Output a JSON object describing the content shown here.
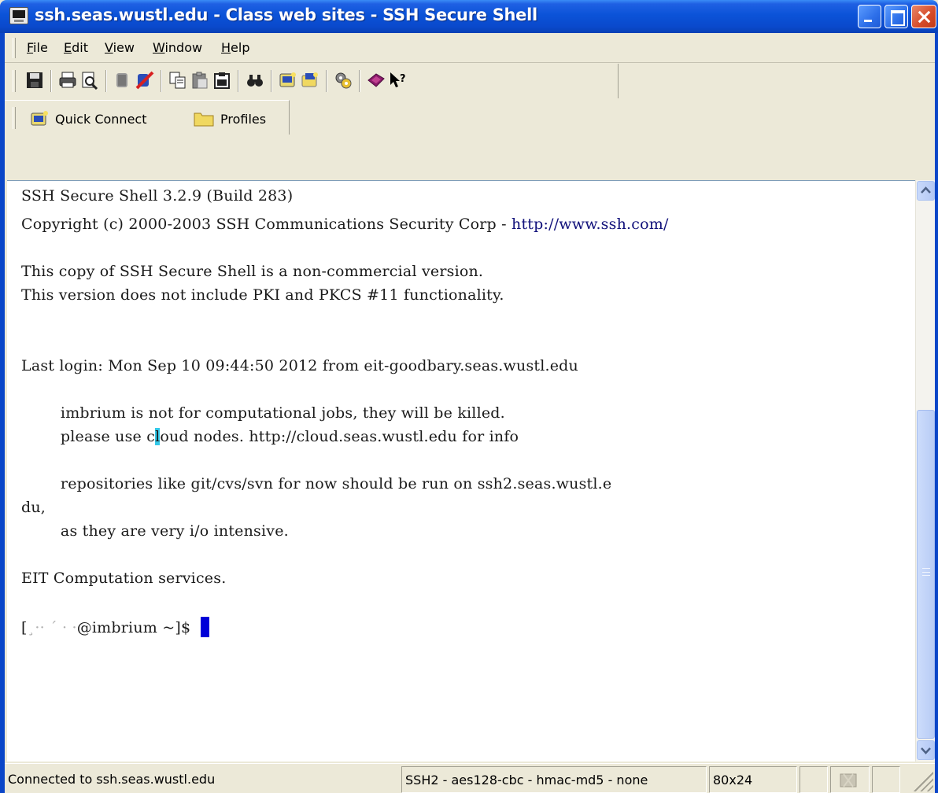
{
  "window": {
    "title": "ssh.seas.wustl.edu - Class web sites - SSH Secure Shell"
  },
  "menu": {
    "items": [
      "File",
      "Edit",
      "View",
      "Window",
      "Help"
    ]
  },
  "toolbar": {
    "icons": [
      "save-icon",
      "print-icon",
      "print-preview-icon",
      "connect-icon",
      "disconnect-icon",
      "copy-icon",
      "paste-icon",
      "paste-special-icon",
      "find-icon",
      "new-terminal-icon",
      "new-file-transfer-icon",
      "settings-icon",
      "help-icon",
      "whats-this-icon"
    ],
    "quick_connect_label": "Quick Connect",
    "profiles_label": "Profiles"
  },
  "terminal": {
    "lines": [
      "SSH Secure Shell 3.2.9 (Build 283)",
      "Copyright (c) 2000-2003 SSH Communications Security Corp - ",
      "This copy of SSH Secure Shell is a non-commercial version.",
      "This version does not include PKI and PKCS #11 functionality.",
      "Last login: Mon Sep 10 09:44:50 2012 from eit-goodbary.seas.wustl.edu",
      "        imbrium is not for computational jobs, they will be killed.",
      "        please use c",
      "l",
      "oud nodes. http://cloud.seas.wustl.edu for info",
      "        repositories like git/cvs/svn for now should be run on ssh2.seas.wustl.e",
      "du,",
      "        as they are very i/o intensive.",
      "EIT Computation services.",
      "[",
      "¸·· ´ · ·",
      "@imbrium ~]$  "
    ],
    "link": "http://www.ssh.com/"
  },
  "status": {
    "connection": "Connected to ssh.seas.wustl.edu",
    "cipher": "SSH2 - aes128-cbc - hmac-md5 - none",
    "size": "80x24"
  }
}
